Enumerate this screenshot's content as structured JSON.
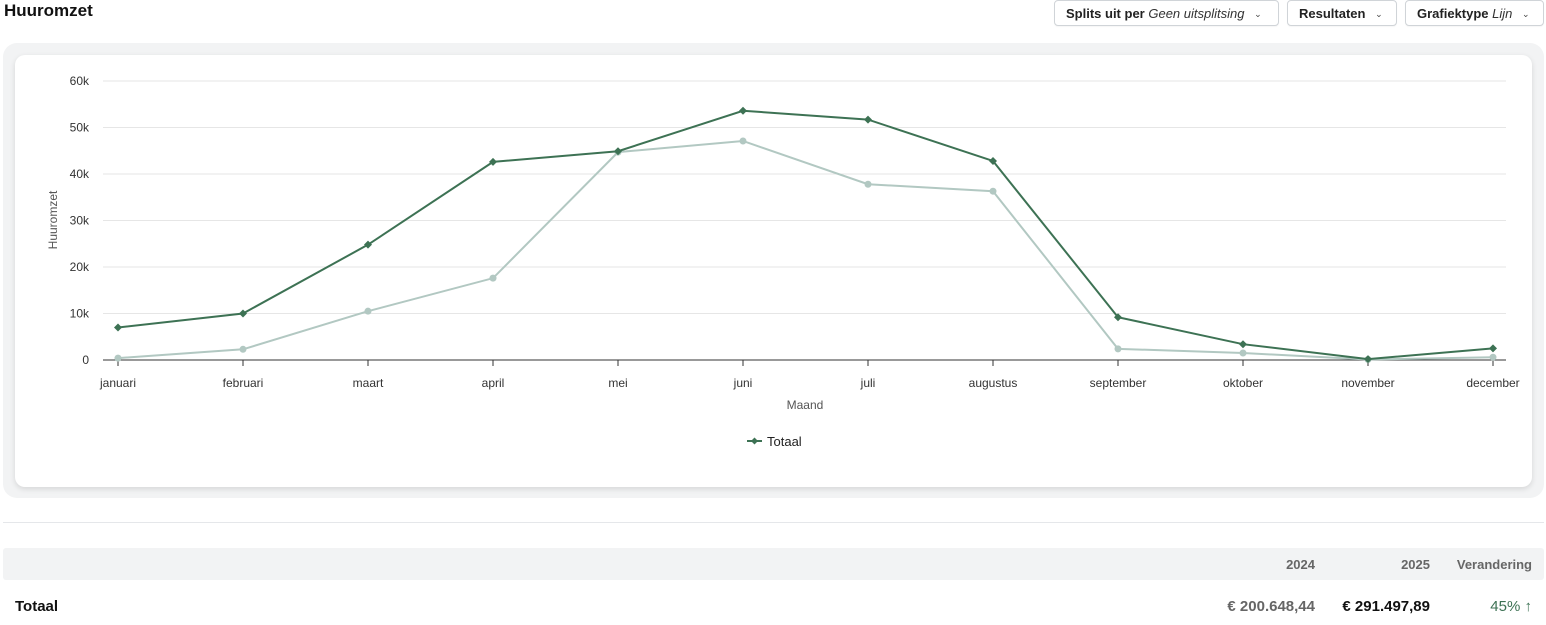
{
  "header": {
    "title": "Huuromzet",
    "split_label": "Splits uit per",
    "split_value": "Geen uitsplitsing",
    "results_label": "Resultaten",
    "charttype_label": "Grafiektype",
    "charttype_value": "Lijn"
  },
  "colors": {
    "current": "#3d7254",
    "previous": "#b2c8c2"
  },
  "chart_data": {
    "type": "line",
    "xlabel": "Maand",
    "ylabel": "Huuromzet",
    "categories": [
      "januari",
      "februari",
      "maart",
      "april",
      "mei",
      "juni",
      "juli",
      "augustus",
      "september",
      "oktober",
      "november",
      "december"
    ],
    "yticks": [
      "0",
      "10k",
      "20k",
      "30k",
      "40k",
      "50k",
      "60k"
    ],
    "ylim": [
      0,
      60000
    ],
    "grid": true,
    "legend_position": "bottom-center",
    "series": [
      {
        "name": "Totaal",
        "values": [
          7000,
          10000,
          24800,
          42600,
          44900,
          53600,
          51700,
          42800,
          9200,
          3400,
          200,
          2500
        ]
      },
      {
        "values": [
          400,
          2300,
          10500,
          17600,
          44700,
          47100,
          37800,
          36300,
          2400,
          1500,
          100,
          600
        ]
      }
    ]
  },
  "table": {
    "headers": [
      "2024",
      "2025",
      "Verandering"
    ],
    "row": {
      "label": "Totaal",
      "v2024": "€ 200.648,44",
      "v2025": "€ 291.497,89",
      "change": "45% ↑"
    }
  }
}
